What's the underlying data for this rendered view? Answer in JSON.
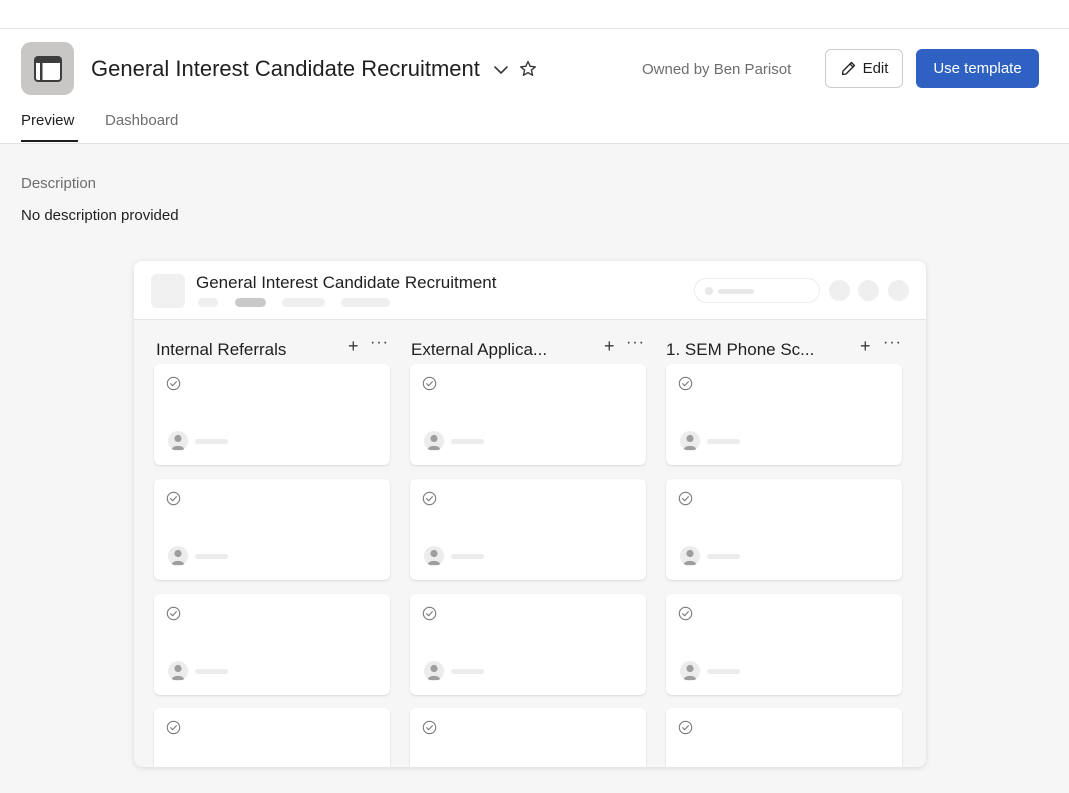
{
  "header": {
    "title": "General Interest Candidate Recruitment",
    "owner": "Owned by Ben Parisot",
    "edit_label": "Edit",
    "use_template_label": "Use template",
    "tabs": [
      {
        "label": "Preview",
        "active": true
      },
      {
        "label": "Dashboard",
        "active": false
      }
    ],
    "icons": {
      "app": "board-template-icon",
      "dropdown": "chevron-down-icon",
      "favorite": "star-icon",
      "edit": "pencil-icon"
    }
  },
  "description": {
    "label": "Description",
    "text": "No description provided"
  },
  "preview": {
    "board_title": "General Interest Candidate Recruitment",
    "columns": [
      {
        "title": "Internal Referrals"
      },
      {
        "title": "External Applica..."
      },
      {
        "title": "1. SEM Phone Sc..."
      }
    ],
    "column_add": "+",
    "column_more": "···"
  },
  "colors": {
    "primary_button": "#2f61c2",
    "app_tile": "#c9c7c6",
    "page_background": "#f6f6f6"
  }
}
